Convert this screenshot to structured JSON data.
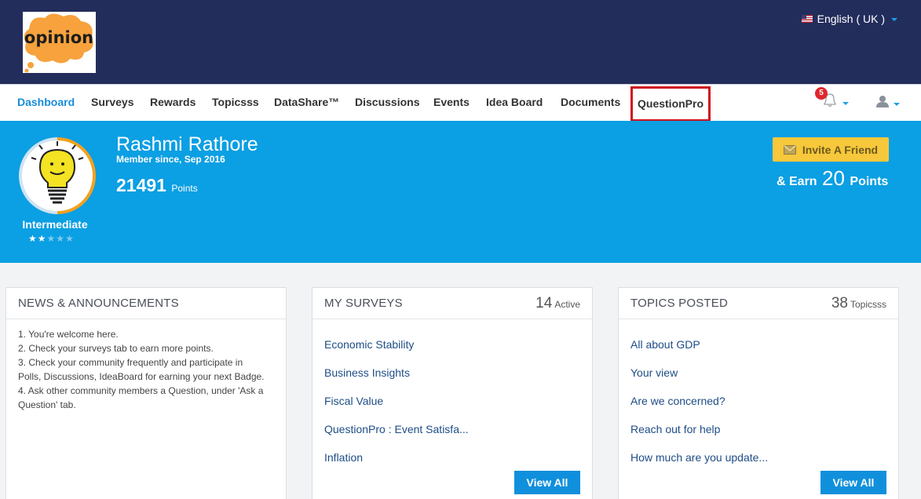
{
  "header": {
    "logo_text": "opinion",
    "language": "English ( UK )"
  },
  "nav": {
    "items": [
      "Dashboard",
      "Surveys",
      "Rewards",
      "Topicsss",
      "DataShare™",
      "Discussions",
      "Events",
      "Idea Board",
      "Documents",
      "QuestionPro"
    ],
    "notifications_count": "5"
  },
  "profile": {
    "name": "Rashmi Rathore",
    "member_since": "Member since, Sep 2016",
    "points": "21491",
    "points_label": "Points",
    "level": "Intermediate",
    "stars_filled": 2,
    "stars_total": 5
  },
  "invite": {
    "button_label": "Invite A Friend",
    "earn_prefix": "& Earn",
    "earn_points": "20",
    "earn_suffix": "Points"
  },
  "news": {
    "title": "NEWS & ANNOUNCEMENTS",
    "lines": [
      "1. You're welcome here.",
      "2. Check your surveys tab to earn more points.",
      "3. Check your community frequently and participate in",
      "Polls, Discussions, IdeaBoard for earning your next Badge.",
      "4. Ask other community members a Question, under 'Ask a",
      "Question' tab."
    ]
  },
  "surveys": {
    "title": "MY SURVEYS",
    "count": "14",
    "count_label": "Active",
    "items": [
      "Economic Stability",
      "Business Insights",
      "Fiscal Value",
      "QuestionPro : Event Satisfa...",
      "Inflation"
    ],
    "view_all": "View All"
  },
  "topics": {
    "title": "TOPICS POSTED",
    "count": "38",
    "count_label": "Topicsss",
    "items": [
      "All about GDP",
      "Your view",
      "Are we concerned?",
      "Reach out for help",
      "How much are you update..."
    ],
    "view_all": "View All"
  },
  "colors": {
    "header_bg": "#232d5c",
    "hero_bg": "#0b9fe3",
    "accent": "#1090dc",
    "invite_bg": "#f7c83b",
    "highlight_border": "#d0131b"
  }
}
